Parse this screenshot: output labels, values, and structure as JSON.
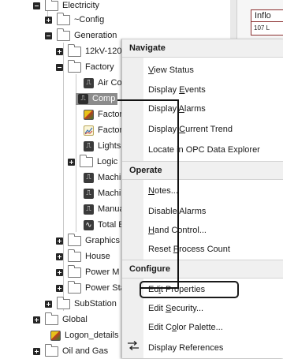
{
  "tree": {
    "items": [
      {
        "label": "Electricity",
        "icon": "folder"
      },
      {
        "label": "~Config",
        "icon": "folder"
      },
      {
        "label": "Generation",
        "icon": "folder"
      },
      {
        "label": "12kV-120",
        "icon": "folder"
      },
      {
        "label": "Factory",
        "icon": "folder"
      },
      {
        "label": "Air Co",
        "icon": "pulse"
      },
      {
        "label": "Comp",
        "icon": "pulse"
      },
      {
        "label": "Factor",
        "icon": "image"
      },
      {
        "label": "Factor",
        "icon": "trend"
      },
      {
        "label": "Lights",
        "icon": "pulse"
      },
      {
        "label": "Logic",
        "icon": "folder"
      },
      {
        "label": "Machi",
        "icon": "pulse"
      },
      {
        "label": "Machi",
        "icon": "pulse"
      },
      {
        "label": "Manua",
        "icon": "pulse"
      },
      {
        "label": "Total E",
        "icon": "wave"
      },
      {
        "label": "Graphics",
        "icon": "folder"
      },
      {
        "label": "House",
        "icon": "folder"
      },
      {
        "label": "Power M",
        "icon": "folder"
      },
      {
        "label": "Power Sta",
        "icon": "folder"
      },
      {
        "label": "SubStation",
        "icon": "folder"
      },
      {
        "label": "Global",
        "icon": "folder"
      },
      {
        "label": "Logon_details",
        "icon": "image"
      },
      {
        "label": "Oil and Gas",
        "icon": "folder"
      }
    ]
  },
  "right_panel": {
    "header_cell": "Inflo",
    "value_cell": "107 L"
  },
  "context_menu": {
    "sections": {
      "navigate": "Navigate",
      "operate": "Operate",
      "configure": "Configure"
    },
    "items": {
      "view_status": {
        "pre": "",
        "ul": "V",
        "post": "iew Status"
      },
      "display_events": {
        "pre": "Display ",
        "ul": "E",
        "post": "vents"
      },
      "display_alarms": {
        "pre": "Display ",
        "ul": "A",
        "post": "larms"
      },
      "display_current_trend": {
        "pre": "Display ",
        "ul": "C",
        "post": "urrent Trend"
      },
      "locate_opc": {
        "pre": "Locate in OPC Data Explorer",
        "ul": "",
        "post": ""
      },
      "notes": {
        "pre": "",
        "ul": "N",
        "post": "otes..."
      },
      "disable_alarms": {
        "pre": "Disable Alarms",
        "ul": "",
        "post": ""
      },
      "hand_control": {
        "pre": "",
        "ul": "H",
        "post": "and Control..."
      },
      "reset_process_count": {
        "pre": "Reset ",
        "ul": "P",
        "post": "rocess Count"
      },
      "edit_properties": {
        "pre": "Ed",
        "ul": "i",
        "post": "t Properties"
      },
      "edit_security": {
        "pre": "Edit ",
        "ul": "S",
        "post": "ecurity..."
      },
      "edit_color_palette": {
        "pre": "Edit C",
        "ul": "o",
        "post": "lor Palette..."
      },
      "display_references": {
        "pre": "Display References",
        "ul": "",
        "post": ""
      }
    }
  },
  "colors": {
    "selection": "#8c8c8c",
    "highlight_border": "#1a1a1a",
    "section_bg": "#f0f0f0"
  }
}
